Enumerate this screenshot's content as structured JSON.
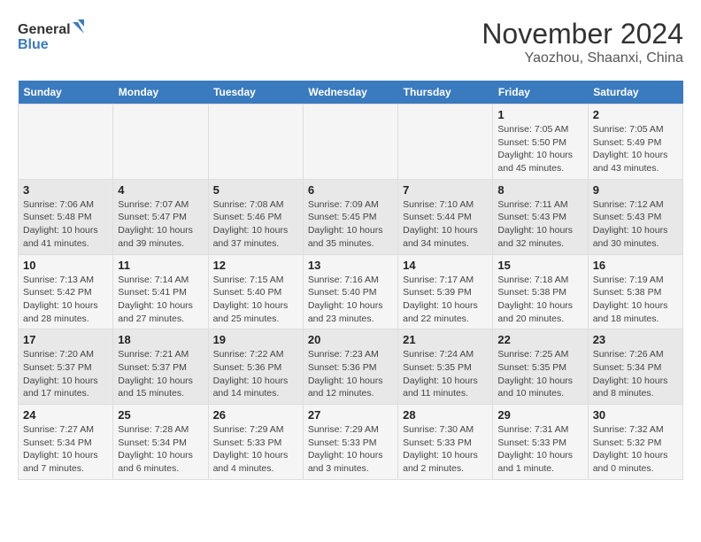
{
  "logo": {
    "line1": "General",
    "line2": "Blue"
  },
  "title": "November 2024",
  "subtitle": "Yaozhou, Shaanxi, China",
  "days_of_week": [
    "Sunday",
    "Monday",
    "Tuesday",
    "Wednesday",
    "Thursday",
    "Friday",
    "Saturday"
  ],
  "weeks": [
    [
      {
        "day": "",
        "info": ""
      },
      {
        "day": "",
        "info": ""
      },
      {
        "day": "",
        "info": ""
      },
      {
        "day": "",
        "info": ""
      },
      {
        "day": "",
        "info": ""
      },
      {
        "day": "1",
        "info": "Sunrise: 7:05 AM\nSunset: 5:50 PM\nDaylight: 10 hours and 45 minutes."
      },
      {
        "day": "2",
        "info": "Sunrise: 7:05 AM\nSunset: 5:49 PM\nDaylight: 10 hours and 43 minutes."
      }
    ],
    [
      {
        "day": "3",
        "info": "Sunrise: 7:06 AM\nSunset: 5:48 PM\nDaylight: 10 hours and 41 minutes."
      },
      {
        "day": "4",
        "info": "Sunrise: 7:07 AM\nSunset: 5:47 PM\nDaylight: 10 hours and 39 minutes."
      },
      {
        "day": "5",
        "info": "Sunrise: 7:08 AM\nSunset: 5:46 PM\nDaylight: 10 hours and 37 minutes."
      },
      {
        "day": "6",
        "info": "Sunrise: 7:09 AM\nSunset: 5:45 PM\nDaylight: 10 hours and 35 minutes."
      },
      {
        "day": "7",
        "info": "Sunrise: 7:10 AM\nSunset: 5:44 PM\nDaylight: 10 hours and 34 minutes."
      },
      {
        "day": "8",
        "info": "Sunrise: 7:11 AM\nSunset: 5:43 PM\nDaylight: 10 hours and 32 minutes."
      },
      {
        "day": "9",
        "info": "Sunrise: 7:12 AM\nSunset: 5:43 PM\nDaylight: 10 hours and 30 minutes."
      }
    ],
    [
      {
        "day": "10",
        "info": "Sunrise: 7:13 AM\nSunset: 5:42 PM\nDaylight: 10 hours and 28 minutes."
      },
      {
        "day": "11",
        "info": "Sunrise: 7:14 AM\nSunset: 5:41 PM\nDaylight: 10 hours and 27 minutes."
      },
      {
        "day": "12",
        "info": "Sunrise: 7:15 AM\nSunset: 5:40 PM\nDaylight: 10 hours and 25 minutes."
      },
      {
        "day": "13",
        "info": "Sunrise: 7:16 AM\nSunset: 5:40 PM\nDaylight: 10 hours and 23 minutes."
      },
      {
        "day": "14",
        "info": "Sunrise: 7:17 AM\nSunset: 5:39 PM\nDaylight: 10 hours and 22 minutes."
      },
      {
        "day": "15",
        "info": "Sunrise: 7:18 AM\nSunset: 5:38 PM\nDaylight: 10 hours and 20 minutes."
      },
      {
        "day": "16",
        "info": "Sunrise: 7:19 AM\nSunset: 5:38 PM\nDaylight: 10 hours and 18 minutes."
      }
    ],
    [
      {
        "day": "17",
        "info": "Sunrise: 7:20 AM\nSunset: 5:37 PM\nDaylight: 10 hours and 17 minutes."
      },
      {
        "day": "18",
        "info": "Sunrise: 7:21 AM\nSunset: 5:37 PM\nDaylight: 10 hours and 15 minutes."
      },
      {
        "day": "19",
        "info": "Sunrise: 7:22 AM\nSunset: 5:36 PM\nDaylight: 10 hours and 14 minutes."
      },
      {
        "day": "20",
        "info": "Sunrise: 7:23 AM\nSunset: 5:36 PM\nDaylight: 10 hours and 12 minutes."
      },
      {
        "day": "21",
        "info": "Sunrise: 7:24 AM\nSunset: 5:35 PM\nDaylight: 10 hours and 11 minutes."
      },
      {
        "day": "22",
        "info": "Sunrise: 7:25 AM\nSunset: 5:35 PM\nDaylight: 10 hours and 10 minutes."
      },
      {
        "day": "23",
        "info": "Sunrise: 7:26 AM\nSunset: 5:34 PM\nDaylight: 10 hours and 8 minutes."
      }
    ],
    [
      {
        "day": "24",
        "info": "Sunrise: 7:27 AM\nSunset: 5:34 PM\nDaylight: 10 hours and 7 minutes."
      },
      {
        "day": "25",
        "info": "Sunrise: 7:28 AM\nSunset: 5:34 PM\nDaylight: 10 hours and 6 minutes."
      },
      {
        "day": "26",
        "info": "Sunrise: 7:29 AM\nSunset: 5:33 PM\nDaylight: 10 hours and 4 minutes."
      },
      {
        "day": "27",
        "info": "Sunrise: 7:29 AM\nSunset: 5:33 PM\nDaylight: 10 hours and 3 minutes."
      },
      {
        "day": "28",
        "info": "Sunrise: 7:30 AM\nSunset: 5:33 PM\nDaylight: 10 hours and 2 minutes."
      },
      {
        "day": "29",
        "info": "Sunrise: 7:31 AM\nSunset: 5:33 PM\nDaylight: 10 hours and 1 minute."
      },
      {
        "day": "30",
        "info": "Sunrise: 7:32 AM\nSunset: 5:32 PM\nDaylight: 10 hours and 0 minutes."
      }
    ]
  ]
}
